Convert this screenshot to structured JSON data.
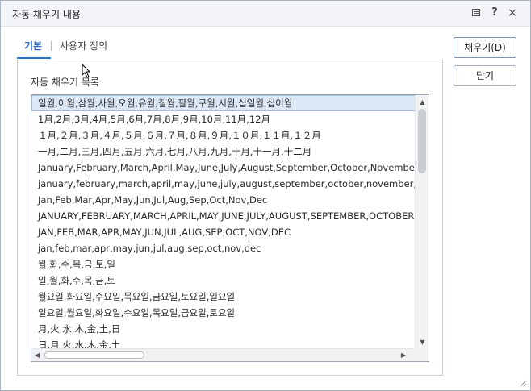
{
  "window": {
    "title": "자동 채우기 내용",
    "help_glyph": "?",
    "close_glyph": "×"
  },
  "tabs": [
    {
      "label": "기본",
      "active": true
    },
    {
      "label": "사용자 정의",
      "active": false
    }
  ],
  "list": {
    "label": "자동 채우기 목록",
    "items": [
      "일월,이월,삼월,사월,오월,유월,칠월,팔월,구월,시월,십일월,십이월",
      "1月,2月,3月,4月,5月,6月,7月,8月,9月,10月,11月,12月",
      "１月,２月,３月,４月,５月,６月,７月,８月,９月,１０月,１１月,１２月",
      "一月,二月,三月,四月,五月,六月,七月,八月,九月,十月,十一月,十二月",
      "January,February,March,April,May,June,July,August,September,October,November,December",
      "january,february,march,april,may,june,july,august,september,october,november,december",
      "Jan,Feb,Mar,Apr,May,Jun,Jul,Aug,Sep,Oct,Nov,Dec",
      "JANUARY,FEBRUARY,MARCH,APRIL,MAY,JUNE,JULY,AUGUST,SEPTEMBER,OCTOBER,NOVEMBER,DECEMBER",
      "JAN,FEB,MAR,APR,MAY,JUN,JUL,AUG,SEP,OCT,NOV,DEC",
      "jan,feb,mar,apr,may,jun,jul,aug,sep,oct,nov,dec",
      "월,화,수,목,금,토,일",
      "일,월,화,수,목,금,토",
      "월요일,화요일,수요일,목요일,금요일,토요일,일요일",
      "일요일,월요일,화요일,수요일,목요일,금요일,토요일",
      "月,火,水,木,金,土,日",
      "日,月,火,水,木,金,土"
    ],
    "selected_index": 0
  },
  "buttons": {
    "fill": "채우기(D)",
    "close": "닫기"
  },
  "colors": {
    "accent": "#2a6fc9",
    "selection": "#dce8f6"
  }
}
